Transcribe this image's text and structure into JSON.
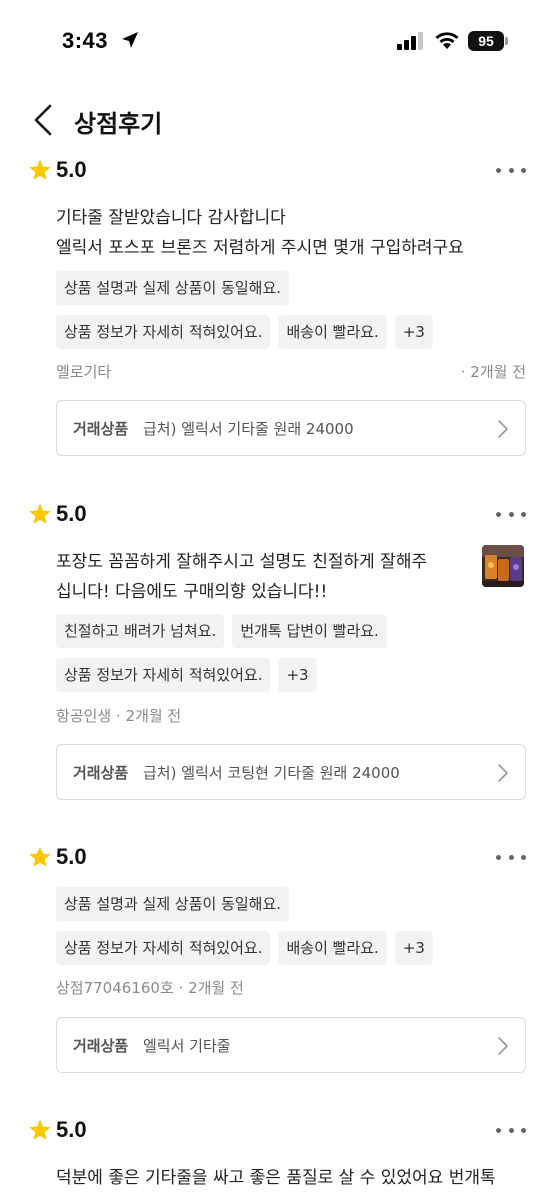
{
  "status_bar": {
    "time": "3:43",
    "battery": "95"
  },
  "header": {
    "title": "상점후기"
  },
  "reviews": [
    {
      "rating": "5.0",
      "text_lines": [
        "기타줄 잘받았습니다 감사합니다",
        "엘릭서 포스포 브론즈 저렴하게 주시면 몇개 구입하려구요"
      ],
      "tags": [
        "상품 설명과 실제 상품이 동일해요.",
        "상품 정보가 자세히 적혀있어요.",
        "배송이 빨라요.",
        "+3"
      ],
      "author": "멜로기타",
      "date": "· 2개월 전",
      "product_label": "거래상품",
      "product_name": "급처) 엘릭서 기타줄 원래 24000"
    },
    {
      "rating": "5.0",
      "text_lines": [
        "포장도 꼼꼼하게 잘해주시고 설명도 친절하게 잘해주",
        "십니다! 다음에도 구매의향 있습니다!!"
      ],
      "tags": [
        "친절하고 배려가 넘쳐요.",
        "번개톡 답변이 빨라요.",
        "상품 정보가 자세히 적혀있어요.",
        "+3"
      ],
      "author": "항공인생",
      "date": "· 2개월 전",
      "product_label": "거래상품",
      "product_name": "급처) 엘릭서 코팅현 기타줄 원래 24000"
    },
    {
      "rating": "5.0",
      "tags": [
        "상품 설명과 실제 상품이 동일해요.",
        "상품 정보가 자세히 적혀있어요.",
        "배송이 빨라요.",
        "+3"
      ],
      "author": "상점77046160호",
      "date": "· 2개월 전",
      "product_label": "거래상품",
      "product_name": "엘릭서 기타줄"
    },
    {
      "rating": "5.0",
      "text_lines": [
        "덕분에 좋은 기타줄을 싸고 좋은 품질로 살 수 있었어요 번개톡"
      ]
    }
  ],
  "colors": {
    "star": "#FFC700",
    "tag_bg": "#F3F3F3",
    "meta": "#8A8A8A",
    "border": "#DCDCDC"
  },
  "icons": {
    "back": "chevron-left-icon",
    "more": "more-horizontal-icon",
    "star": "star-icon",
    "chevron": "chevron-right-icon"
  }
}
